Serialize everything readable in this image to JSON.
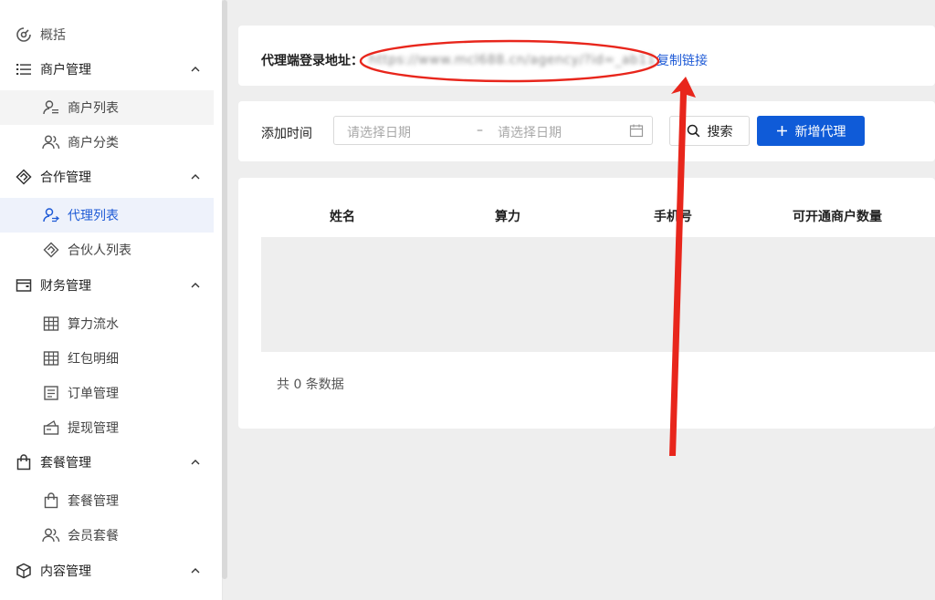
{
  "sidebar": {
    "groups": [
      {
        "label": "概括",
        "icon": "dashboard-icon"
      },
      {
        "label": "商户管理",
        "icon": "list-icon"
      },
      {
        "label": "合作管理",
        "icon": "handshake-icon"
      },
      {
        "label": "财务管理",
        "icon": "wallet-icon"
      },
      {
        "label": "套餐管理",
        "icon": "bag-icon"
      },
      {
        "label": "内容管理",
        "icon": "cube-icon"
      }
    ],
    "items": [
      {
        "label": "商户列表",
        "icon": "user-list-icon"
      },
      {
        "label": "商户分类",
        "icon": "users-icon"
      },
      {
        "label": "代理列表",
        "icon": "user-agent-icon"
      },
      {
        "label": "合伙人列表",
        "icon": "handshake-icon"
      },
      {
        "label": "算力流水",
        "icon": "table-icon"
      },
      {
        "label": "红包明细",
        "icon": "table-icon"
      },
      {
        "label": "订单管理",
        "icon": "document-icon"
      },
      {
        "label": "提现管理",
        "icon": "withdraw-icon"
      },
      {
        "label": "套餐管理",
        "icon": "bag-icon"
      },
      {
        "label": "会员套餐",
        "icon": "users-icon"
      }
    ]
  },
  "url_bar": {
    "label": "代理端登录地址：",
    "value": "https://www.mcl688.cn/agency/?id=_ab11",
    "copy_label": "复制链接"
  },
  "filter": {
    "label": "添加时间",
    "start_placeholder": "请选择日期",
    "separator": "–",
    "end_placeholder": "请选择日期",
    "search_label": "搜索",
    "add_label": "新增代理"
  },
  "table": {
    "columns": [
      "姓名",
      "算力",
      "手机号",
      "可开通商户数量"
    ],
    "total_text": "共 0 条数据"
  },
  "colors": {
    "primary": "#0f5bd8",
    "annotation": "#e8261c"
  }
}
